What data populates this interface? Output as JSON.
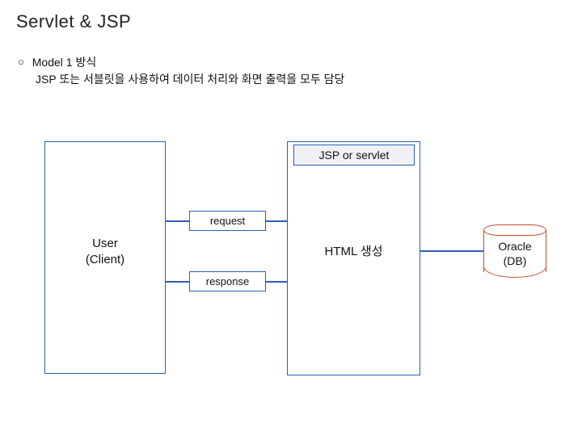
{
  "title": "Servlet & JSP",
  "bullet": {
    "marker": "○",
    "label": "Model 1 방식",
    "description": "JSP 또는 서블릿을 사용하여 데이터 처리와 화면 출력을 모두 담당"
  },
  "diagram": {
    "user_box": {
      "line1": "User",
      "line2": "(Client)"
    },
    "jsp_box": {
      "header": "JSP or servlet",
      "body": "HTML 생성"
    },
    "request_label": "request",
    "response_label": "response",
    "db": {
      "line1": "Oracle",
      "line2": "(DB)"
    }
  }
}
